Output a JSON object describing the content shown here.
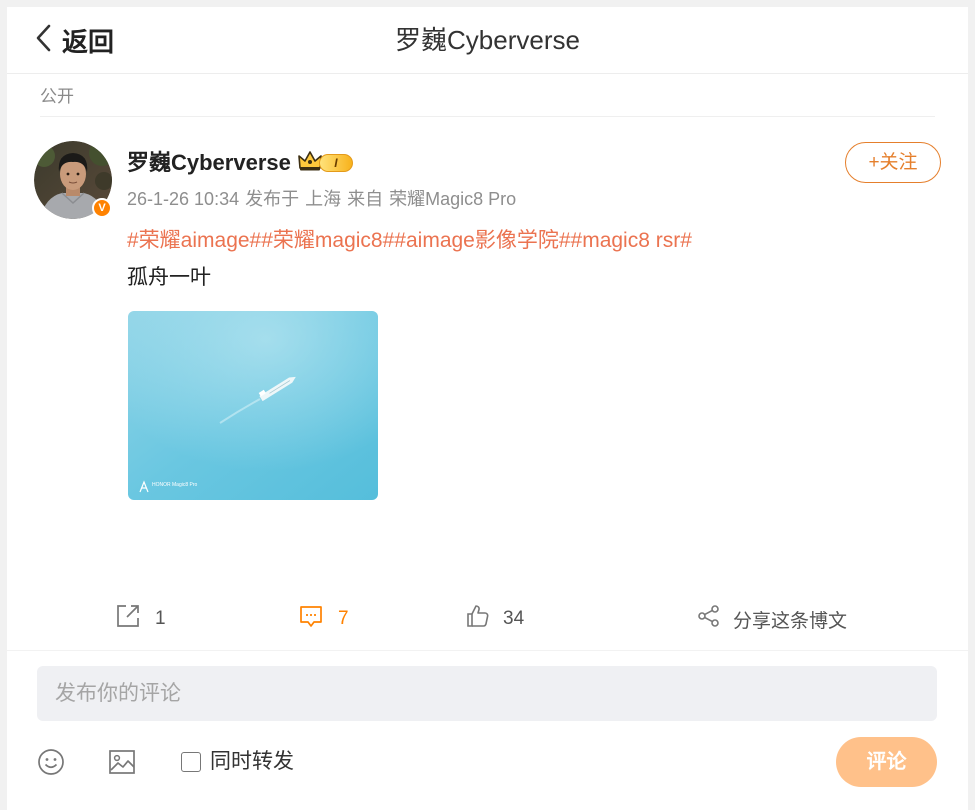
{
  "header": {
    "back_label": "返回",
    "title": "罗巍Cyberverse"
  },
  "visibility": "公开",
  "post": {
    "author": {
      "name": "罗巍Cyberverse",
      "verified_badge": "V",
      "member_badge": "I"
    },
    "follow_label": "+关注",
    "meta": {
      "time": "26-1-26 10:34",
      "location_prefix": "发布于",
      "location": "上海",
      "source_prefix": "来自",
      "source": "荣耀Magic8 Pro"
    },
    "hashtags": [
      "#荣耀aimage#",
      "#荣耀magic8#",
      "#aimage影像学院#",
      "#magic8 rsr#"
    ],
    "text": "孤舟一叶",
    "image": {
      "watermark": "HONOR Magic8 Pro"
    }
  },
  "actions": {
    "repost_count": "1",
    "comment_count": "7",
    "like_count": "34",
    "share_label": "分享这条博文"
  },
  "comment_box": {
    "placeholder": "发布你的评论",
    "repost_also_label": "同时转发",
    "repost_also_checked": false,
    "submit_label": "评论"
  },
  "icons": {
    "back": "chevron-left-icon",
    "verified": "verified-v-icon",
    "crown": "crown-icon",
    "repost": "repost-icon",
    "comment": "comment-icon",
    "like": "thumbs-up-icon",
    "share": "share-icon",
    "emoji": "smiley-icon",
    "image": "image-icon"
  },
  "colors": {
    "accent_orange": "#ff8200",
    "hashtag": "#eb7350",
    "follow": "#e57f2c",
    "submit_bg": "#ffc18a",
    "meta_gray": "#8e8e8e",
    "input_bg": "#eff0f3"
  }
}
